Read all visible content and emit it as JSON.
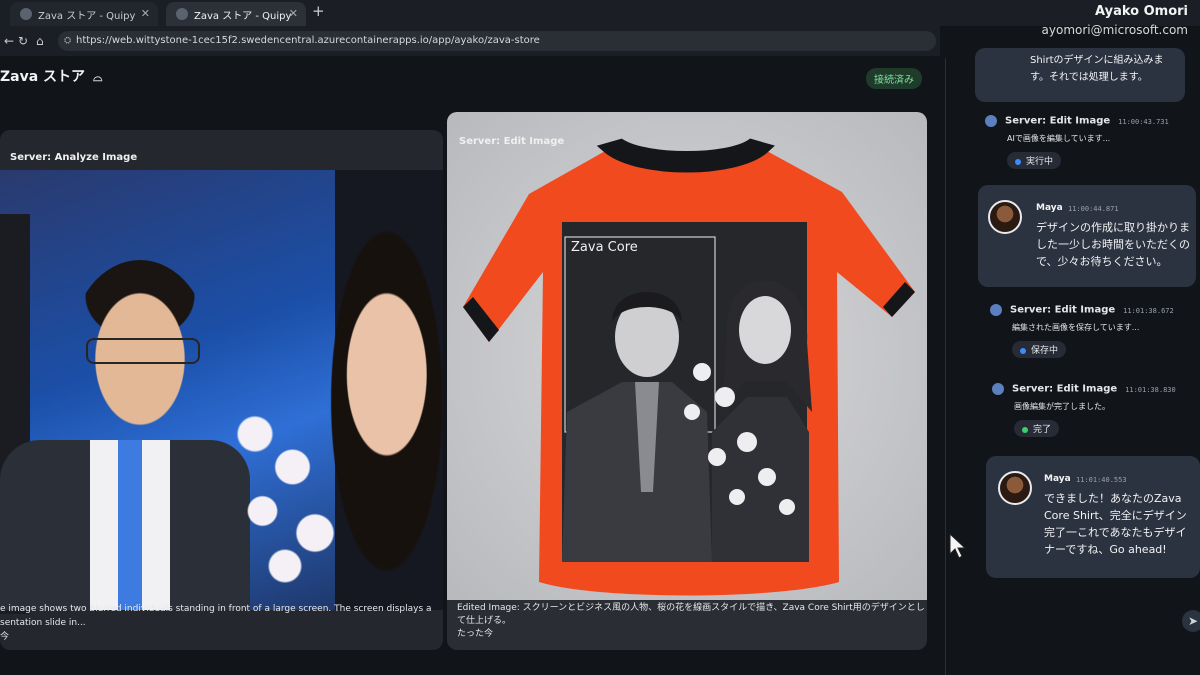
{
  "browser": {
    "tabs": [
      {
        "label": "Zava ストア - Quipy"
      },
      {
        "label": "Zava ストア - Quipy"
      }
    ],
    "url": "https://web.wittystone-1cec15f2.swedencentral.azurecontainerapps.io/app/ayako/zava-store",
    "user_name": "Ayako Omori",
    "user_email": "ayomori@microsoft.com"
  },
  "app": {
    "title": "Zava ストア",
    "status": "接続済み"
  },
  "cards": {
    "analyze": {
      "title": "Server: Analyze Image",
      "caption": "e image shows two blurred individuals standing in front of a large screen. The screen displays a sentation slide in...",
      "time": "今"
    },
    "edit": {
      "title": "Server: Edit Image",
      "shirt_label": "Zava Core",
      "caption": "Edited Image: スクリーンとビジネス風の人物、桜の花を線画スタイルで描き、Zava Core Shirt用のデザインとして仕上げる。",
      "time": "たった今"
    }
  },
  "chat": {
    "top_bubble": "Shirtのデザインに組み込みます。それでは処理します。",
    "events": [
      {
        "title": "Server: Edit Image",
        "ts": "11:00:43.731",
        "msg": "AIで画像を編集しています...",
        "pill": "実行中",
        "dot_color": "#3d8bff"
      },
      {
        "title": "Server: Edit Image",
        "ts": "11:01:38.672",
        "msg": "編集された画像を保存しています...",
        "pill": "保存中",
        "dot_color": "#3d8bff"
      },
      {
        "title": "Server: Edit Image",
        "ts": "11:01:38.830",
        "msg": "画像編集が完了しました。",
        "pill": "完了",
        "dot_color": "#3ecf6b"
      }
    ],
    "messages": [
      {
        "name": "Maya",
        "ts": "11:00:44.871",
        "text": "デザインの作成に取り掛かりました一少しお時間をいただくので、少々お待ちください。"
      },
      {
        "name": "Maya",
        "ts": "11:01:40.553",
        "text": "できました！あなたのZava Core Shirt、完全にデザイン完了一これであなたもデザイナーですね、Go ahead!"
      }
    ]
  }
}
